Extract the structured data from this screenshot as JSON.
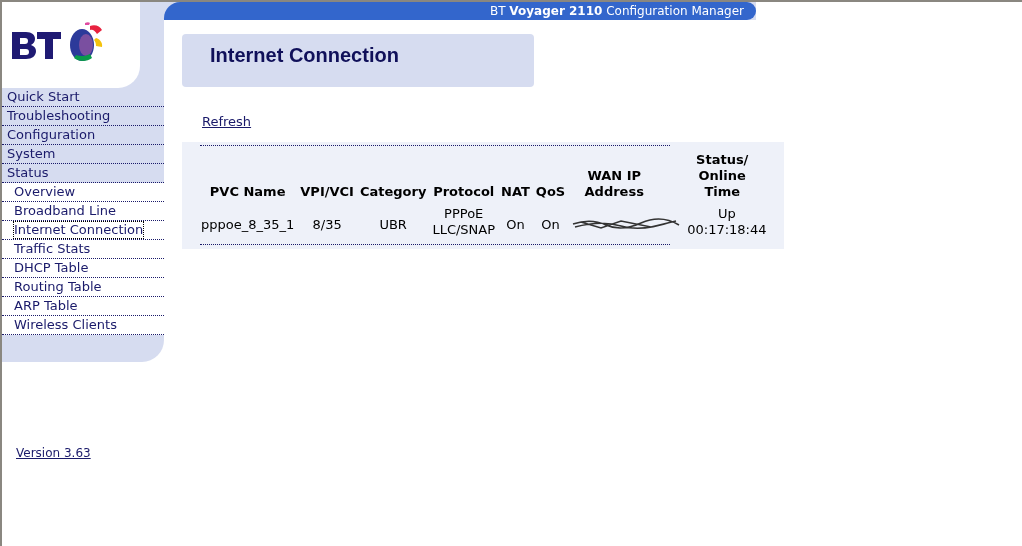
{
  "banner": {
    "title": "BT **Voyager 2110** Configuration Manager"
  },
  "sidebar": {
    "items": [
      {
        "label": "Quick Start",
        "kind": "top",
        "selected": false
      },
      {
        "label": "Troubleshooting",
        "kind": "top",
        "selected": false
      },
      {
        "label": "Configuration",
        "kind": "top",
        "selected": false
      },
      {
        "label": "System",
        "kind": "top",
        "selected": false
      },
      {
        "label": "Status",
        "kind": "top",
        "selected": false
      },
      {
        "label": "Overview",
        "kind": "sub",
        "selected": false
      },
      {
        "label": "Broadband Line",
        "kind": "sub",
        "selected": false
      },
      {
        "label": "Internet Connection",
        "kind": "sub",
        "selected": true
      },
      {
        "label": "Traffic Stats",
        "kind": "sub",
        "selected": false
      },
      {
        "label": "DHCP Table",
        "kind": "sub",
        "selected": false
      },
      {
        "label": "Routing Table",
        "kind": "sub",
        "selected": false
      },
      {
        "label": "ARP Table",
        "kind": "sub",
        "selected": false
      },
      {
        "label": "Wireless Clients",
        "kind": "sub",
        "selected": false
      }
    ],
    "version_link": "Version 3.63"
  },
  "page": {
    "title": "Internet Connection",
    "refresh_link": "Refresh"
  },
  "table": {
    "columns": [
      "PVC Name",
      "VPI/VCI",
      "Category",
      "Protocol",
      "NAT",
      "QoS",
      "WAN IP Address",
      "Status/ Online Time"
    ],
    "rows": [
      [
        {
          "kind": "text",
          "lines": [
            "pppoe_8_35_1"
          ]
        },
        {
          "kind": "text",
          "lines": [
            "8/35"
          ]
        },
        {
          "kind": "text",
          "lines": [
            "UBR"
          ]
        },
        {
          "kind": "text",
          "lines": [
            "PPPoE",
            "LLC/SNAP"
          ]
        },
        {
          "kind": "text",
          "lines": [
            "On"
          ]
        },
        {
          "kind": "text",
          "lines": [
            "On"
          ]
        },
        {
          "kind": "redacted"
        },
        {
          "kind": "text",
          "lines": [
            "Up",
            "00:17:18:44"
          ]
        }
      ]
    ]
  }
}
